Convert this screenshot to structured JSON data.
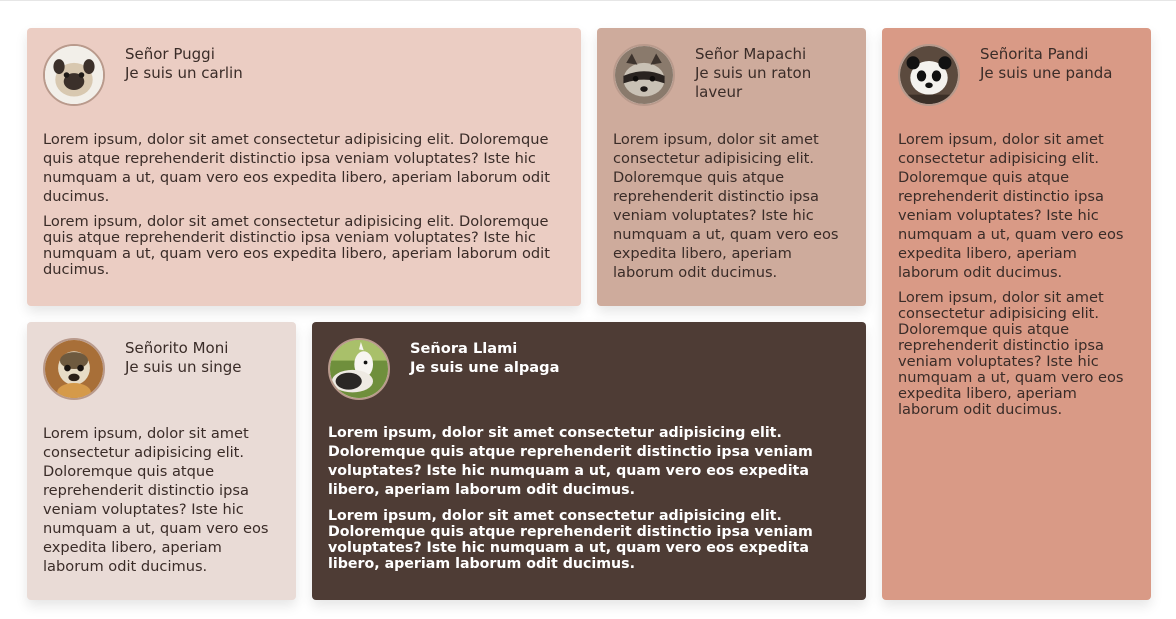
{
  "cards": [
    {
      "name": "Señor Puggi",
      "role": "Je suis un carlin",
      "avatar_icon": "pug-avatar-icon",
      "paragraphs": [
        "Lorem ipsum, dolor sit amet consectetur adipisicing elit. Doloremque quis atque reprehenderit distinctio ipsa veniam voluptates? Iste hic numquam a ut, quam vero eos expedita libero, aperiam laborum odit ducimus.",
        "Lorem ipsum, dolor sit amet consectetur adipisicing elit. Doloremque quis atque reprehenderit distinctio ipsa veniam voluptates? Iste hic numquam a ut, quam vero eos expedita libero, aperiam laborum odit ducimus."
      ]
    },
    {
      "name": "Señor Mapachi",
      "role": "Je suis un raton laveur",
      "avatar_icon": "raccoon-avatar-icon",
      "paragraphs": [
        "Lorem ipsum, dolor sit amet consectetur adipisicing elit. Doloremque quis atque reprehenderit distinctio ipsa veniam voluptates? Iste hic numquam a ut, quam vero eos expedita libero, aperiam laborum odit ducimus."
      ]
    },
    {
      "name": "Señorita Pandi",
      "role": "Je suis une panda",
      "avatar_icon": "panda-avatar-icon",
      "paragraphs": [
        "Lorem ipsum, dolor sit amet consectetur adipisicing elit. Doloremque quis atque reprehenderit distinctio ipsa veniam voluptates? Iste hic numquam a ut, quam vero eos expedita libero, aperiam laborum odit ducimus.",
        "Lorem ipsum, dolor sit amet consectetur adipisicing elit. Doloremque quis atque reprehenderit distinctio ipsa veniam voluptates? Iste hic numquam a ut, quam vero eos expedita libero, aperiam laborum odit ducimus."
      ]
    },
    {
      "name": "Señorito Moni",
      "role": "Je suis un singe",
      "avatar_icon": "monkey-avatar-icon",
      "paragraphs": [
        "Lorem ipsum, dolor sit amet consectetur adipisicing elit. Doloremque quis atque reprehenderit distinctio ipsa veniam voluptates? Iste hic numquam a ut, quam vero eos expedita libero, aperiam laborum odit ducimus."
      ]
    },
    {
      "name": "Señora Llami",
      "role": "Je suis une alpaga",
      "avatar_icon": "alpaca-avatar-icon",
      "paragraphs": [
        "Lorem ipsum, dolor sit amet consectetur adipisicing elit. Doloremque quis atque reprehenderit distinctio ipsa veniam voluptates? Iste hic numquam a ut, quam vero eos expedita libero, aperiam laborum odit ducimus.",
        "Lorem ipsum, dolor sit amet consectetur adipisicing elit. Doloremque quis atque reprehenderit distinctio ipsa veniam voluptates? Iste hic numquam a ut, quam vero eos expedita libero, aperiam laborum odit ducimus."
      ]
    }
  ],
  "colors": {
    "card_puggi": "#ebcdc3",
    "card_mapachi": "#ceab9c",
    "card_pandi": "#d99a86",
    "card_moni": "#e9dbd6",
    "card_llami": "#4e3c35"
  }
}
